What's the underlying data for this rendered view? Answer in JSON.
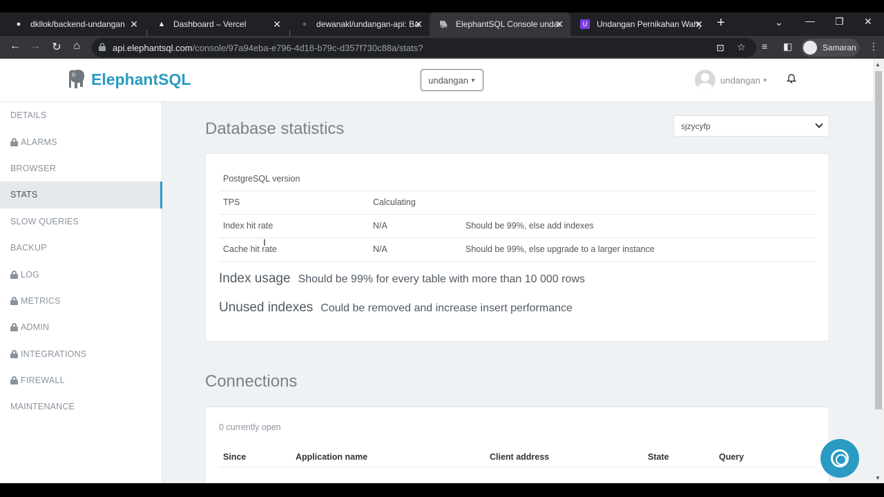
{
  "browser": {
    "tabs": [
      {
        "title": "dkllok/backend-undangan",
        "icon": "github-icon"
      },
      {
        "title": "Dashboard – Vercel",
        "icon": "vercel-icon"
      },
      {
        "title": "dewanakl/undangan-api: Bac",
        "icon": "github-icon"
      },
      {
        "title": "ElephantSQL Console undan",
        "icon": "elephant-icon",
        "active": true
      },
      {
        "title": "Undangan Pernikahan Wahy",
        "icon": "site-icon"
      }
    ],
    "url_host": "api.elephantsql.com",
    "url_path": "/console/97a94eba-e796-4d18-b79c-d357f730c88a/stats?",
    "profile_name": "Samaran"
  },
  "header": {
    "brand": "ElephantSQL",
    "instance": "undangan",
    "user": "undangan"
  },
  "sidebar": {
    "items": [
      {
        "label": "DETAILS",
        "locked": false
      },
      {
        "label": "ALARMS",
        "locked": true
      },
      {
        "label": "BROWSER",
        "locked": false
      },
      {
        "label": "STATS",
        "locked": false,
        "active": true
      },
      {
        "label": "SLOW QUERIES",
        "locked": false
      },
      {
        "label": "BACKUP",
        "locked": false
      },
      {
        "label": "LOG",
        "locked": true
      },
      {
        "label": "METRICS",
        "locked": true
      },
      {
        "label": "ADMIN",
        "locked": true
      },
      {
        "label": "INTEGRATIONS",
        "locked": true
      },
      {
        "label": "FIREWALL",
        "locked": true
      },
      {
        "label": "MAINTENANCE",
        "locked": false
      }
    ]
  },
  "stats": {
    "title": "Database statistics",
    "database": "sjzycyfp",
    "rows": [
      {
        "name": "PostgreSQL version",
        "value": "",
        "note": ""
      },
      {
        "name": "TPS",
        "value": "Calculating",
        "note": ""
      },
      {
        "name": "Index hit rate",
        "value": "N/A",
        "note": "Should be 99%, else add indexes"
      },
      {
        "name": "Cache hit rate",
        "value": "N/A",
        "note": "Should be 99%, else upgrade to a larger instance"
      }
    ],
    "index_usage": {
      "label": "Index usage",
      "text": "Should be 99% for every table with more than 10 000 rows"
    },
    "unused_indexes": {
      "label": "Unused indexes",
      "text": "Could be removed and increase insert performance"
    }
  },
  "connections": {
    "title": "Connections",
    "count_text": "0 currently open",
    "columns": [
      "Since",
      "Application name",
      "Client address",
      "State",
      "Query"
    ]
  },
  "colors": {
    "accent": "#2a9bc2",
    "page_bg": "#eef2f5"
  }
}
